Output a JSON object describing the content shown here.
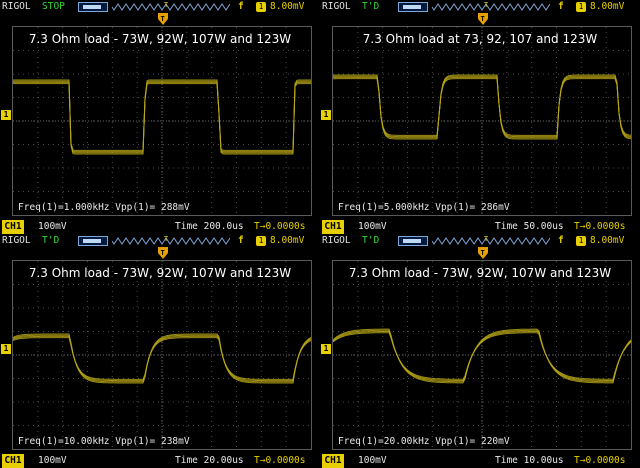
{
  "colors": {
    "trace": "#b9a716",
    "grid": "#4a4a4a",
    "accent": "#e8d000",
    "running": "#2fd82f"
  },
  "icons": {
    "trigger": "trigger-edge-icon",
    "channel": "channel-marker-icon",
    "tmark": "trigger-position-icon"
  },
  "panels": [
    {
      "brand": "RIGOL",
      "state": "STOP",
      "trig_edge": "f",
      "trig_src": "1",
      "trig_level": "8.00mV",
      "title": "7.3 Ohm load - 73W, 92W, 107W and 123W",
      "measure": "Freq(1)=1.000kHz  Vpp(1)= 288mV",
      "ch": "CH1",
      "ch_scale": "100mV",
      "time": "Time 200.0us",
      "toffset": "0.0000s",
      "wave": {
        "cycles": 2,
        "rise": 0.0
      }
    },
    {
      "brand": "RIGOL",
      "state": "T'D",
      "trig_edge": "f",
      "trig_src": "1",
      "trig_level": "8.00mV",
      "title": "7.3 Ohm load at 73, 92, 107 and 123W",
      "measure": "Freq(1)=5.000kHz  Vpp(1)= 286mV",
      "ch": "CH1",
      "ch_scale": "100mV",
      "time": "Time 50.00us",
      "toffset": "0.0000s",
      "wave": {
        "cycles": 2.5,
        "rise": 0.15
      }
    },
    {
      "brand": "RIGOL",
      "state": "T'D",
      "trig_edge": "f",
      "trig_src": "1",
      "trig_level": "8.00mV",
      "title": "7.3 Ohm load - 73W, 92W, 107W and 123W",
      "measure": "Freq(1)=10.00kHz  Vpp(1)= 238mV",
      "ch": "CH1",
      "ch_scale": "100mV",
      "time": "Time 20.00us",
      "toffset": "0.0000s",
      "wave": {
        "cycles": 2,
        "rise": 0.35
      }
    },
    {
      "brand": "RIGOL",
      "state": "T'D",
      "trig_edge": "f",
      "trig_src": "1",
      "trig_level": "8.00mV",
      "title": "7.3 Ohm load - 73W, 92W, 107W and 123W",
      "measure": "Freq(1)=20.00kHz  Vpp(1)= 220mV",
      "ch": "CH1",
      "ch_scale": "100mV",
      "time": "Time 10.00us",
      "toffset": "0.0000s",
      "wave": {
        "cycles": 2,
        "rise": 0.6
      }
    }
  ]
}
